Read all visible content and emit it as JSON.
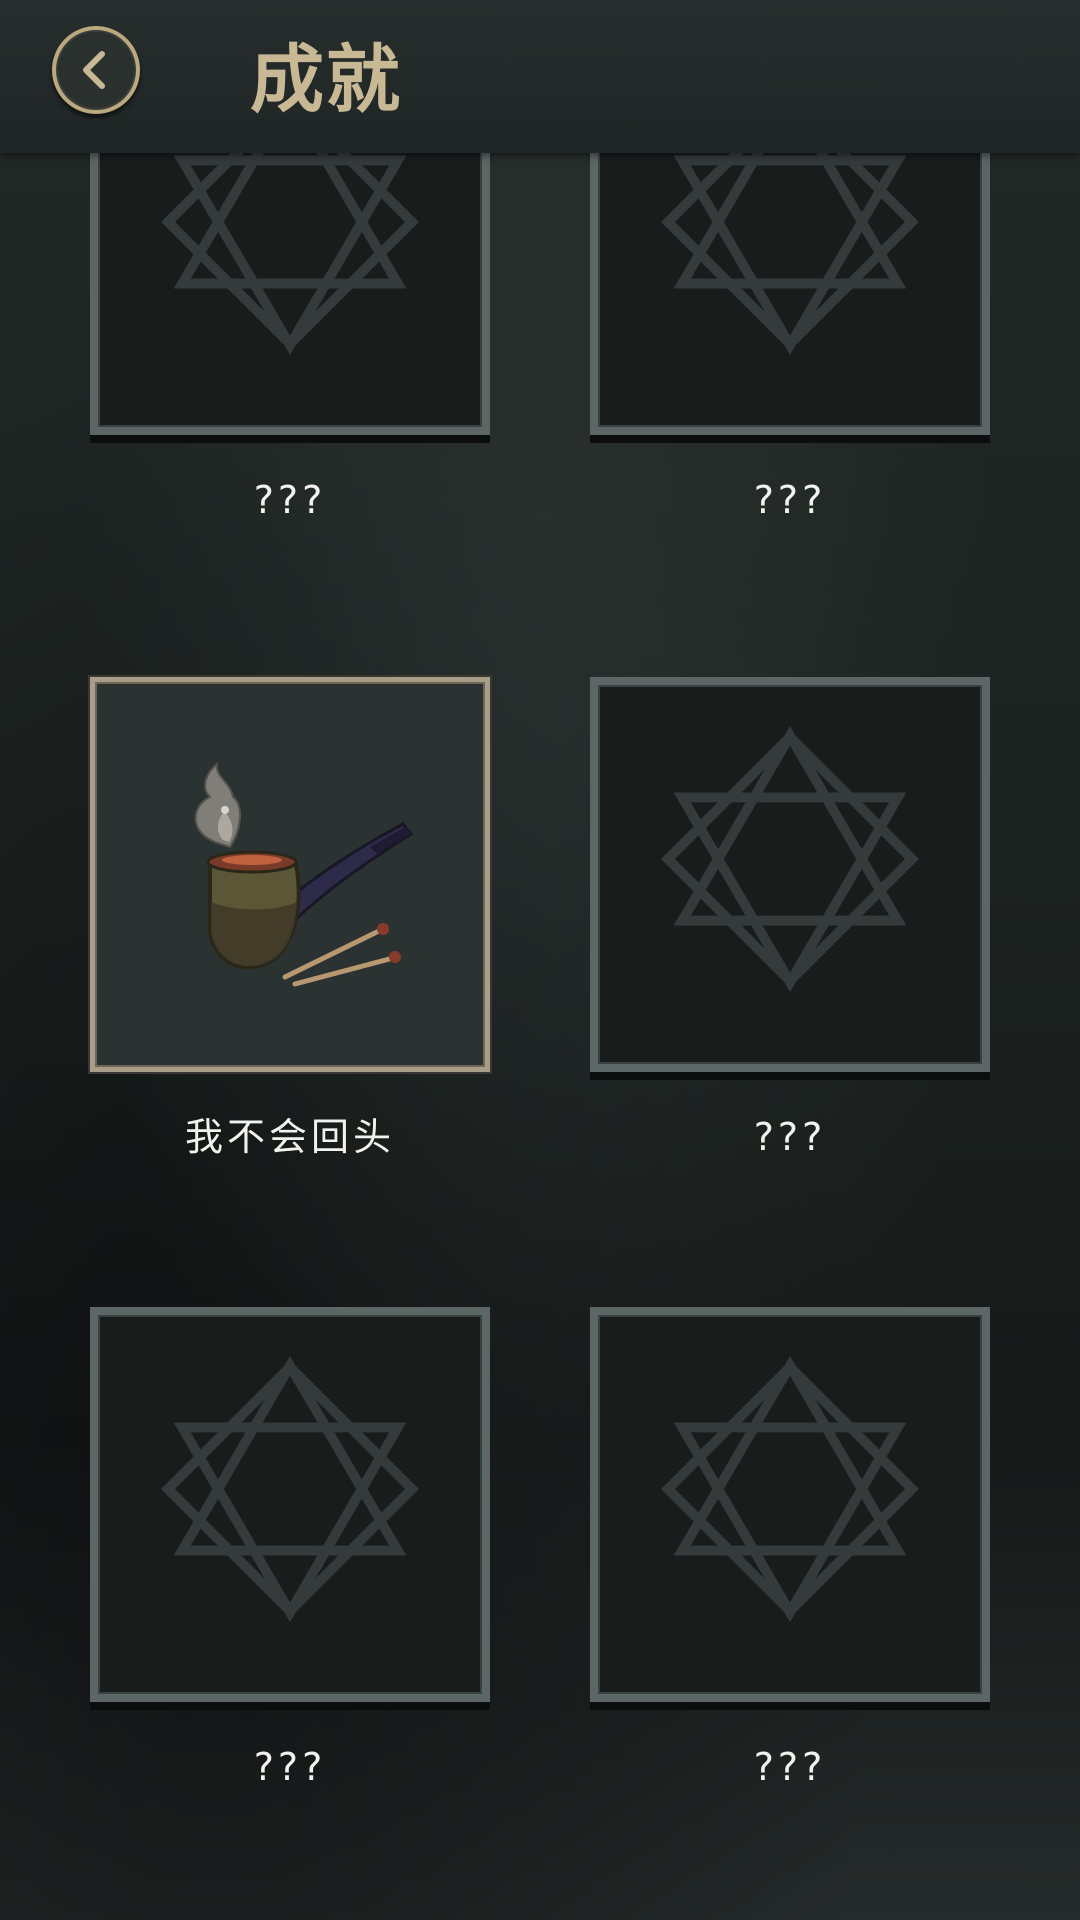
{
  "header": {
    "title": "成就",
    "back_icon": "chevron-left-icon"
  },
  "colors": {
    "accent_gold": "#c8b994",
    "frame_locked": "#5c6665",
    "frame_unlocked": "#a89d86",
    "label_text": "#f2f2ee"
  },
  "achievements": [
    {
      "label": "???",
      "locked": true,
      "icon": "star-placeholder-icon"
    },
    {
      "label": "???",
      "locked": true,
      "icon": "star-placeholder-icon"
    },
    {
      "label": "我不会回头",
      "locked": false,
      "icon": "pipe-icon"
    },
    {
      "label": "???",
      "locked": true,
      "icon": "star-placeholder-icon"
    },
    {
      "label": "???",
      "locked": true,
      "icon": "star-placeholder-icon"
    },
    {
      "label": "???",
      "locked": true,
      "icon": "star-placeholder-icon"
    }
  ]
}
